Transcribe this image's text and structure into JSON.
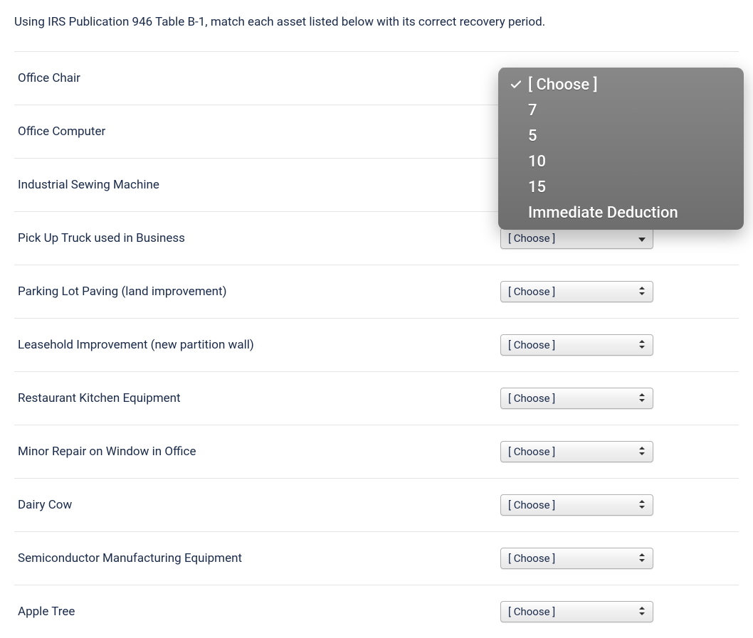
{
  "instruction": "Using IRS Publication 946 Table B-1, match each asset listed below with its correct recovery period.",
  "choose_placeholder": "[ Choose ]",
  "rows": [
    {
      "label": "Office Chair"
    },
    {
      "label": "Office Computer"
    },
    {
      "label": "Industrial Sewing Machine"
    },
    {
      "label": "Pick Up Truck used in Business"
    },
    {
      "label": "Parking Lot Paving (land improvement)"
    },
    {
      "label": "Leasehold Improvement (new partition wall)"
    },
    {
      "label": "Restaurant Kitchen Equipment"
    },
    {
      "label": "Minor Repair on Window in Office"
    },
    {
      "label": "Dairy Cow"
    },
    {
      "label": "Semiconductor Manufacturing Equipment"
    },
    {
      "label": "Apple Tree"
    }
  ],
  "open_row_index": 0,
  "dropdown_options": [
    "[ Choose ]",
    "7",
    "5",
    "10",
    "15",
    "Immediate Deduction"
  ],
  "selected_option_index": 0
}
